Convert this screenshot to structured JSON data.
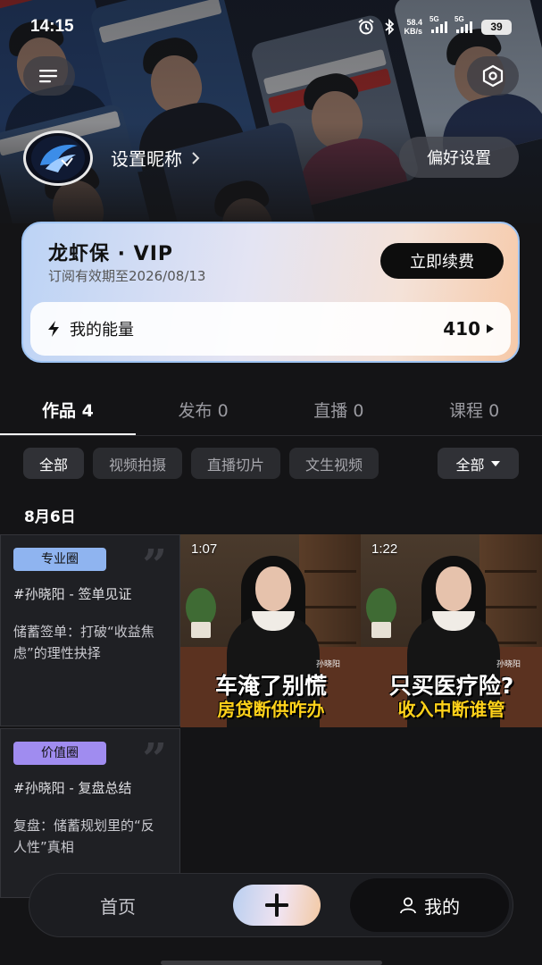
{
  "status_bar": {
    "time": "14:15",
    "net_speed": "58.4",
    "net_unit": "KB/s",
    "sim1": "5G",
    "sim2": "5G",
    "battery": "39"
  },
  "header": {
    "menu_icon": "menu-icon",
    "settings_icon": "hexagon-settings-icon",
    "nickname": "设置昵称",
    "preferences_button": "偏好设置"
  },
  "vip": {
    "title": "龙虾保 · VIP",
    "subtitle": "订阅有效期至2026/08/13",
    "renew_button": "立即续费",
    "energy_label": "我的能量",
    "energy_value": "410"
  },
  "tabs": [
    {
      "label": "作品 4",
      "active": true
    },
    {
      "label": "发布 0",
      "active": false
    },
    {
      "label": "直播 0",
      "active": false
    },
    {
      "label": "课程 0",
      "active": false
    }
  ],
  "chips": [
    "全部",
    "视频拍摄",
    "直播切片",
    "文生视频"
  ],
  "filter_dropdown": "全部",
  "date_header": "8月6日",
  "text_cards": [
    {
      "badge": "专业圈",
      "badge_color": "#8fb4f0",
      "title": "#孙晓阳 - 签单见证",
      "body": "储蓄签单：打破“收益焦虑”的理性抉择"
    },
    {
      "badge": "价值圈",
      "badge_color": "#a08cf0",
      "title": "#孙晓阳 - 复盘总结",
      "body": "复盘：储蓄规划里的“反人性”真相"
    }
  ],
  "videos": [
    {
      "duration": "1:07",
      "presenter": "孙晓阳",
      "caption_line1": "车淹了别慌",
      "caption_line2": "房贷断供咋办"
    },
    {
      "duration": "1:22",
      "presenter": "孙晓阳",
      "caption_line1": "只买医疗险?",
      "caption_line2": "收入中断谁管"
    }
  ],
  "bottom_nav": {
    "home": "首页",
    "mine": "我的"
  }
}
